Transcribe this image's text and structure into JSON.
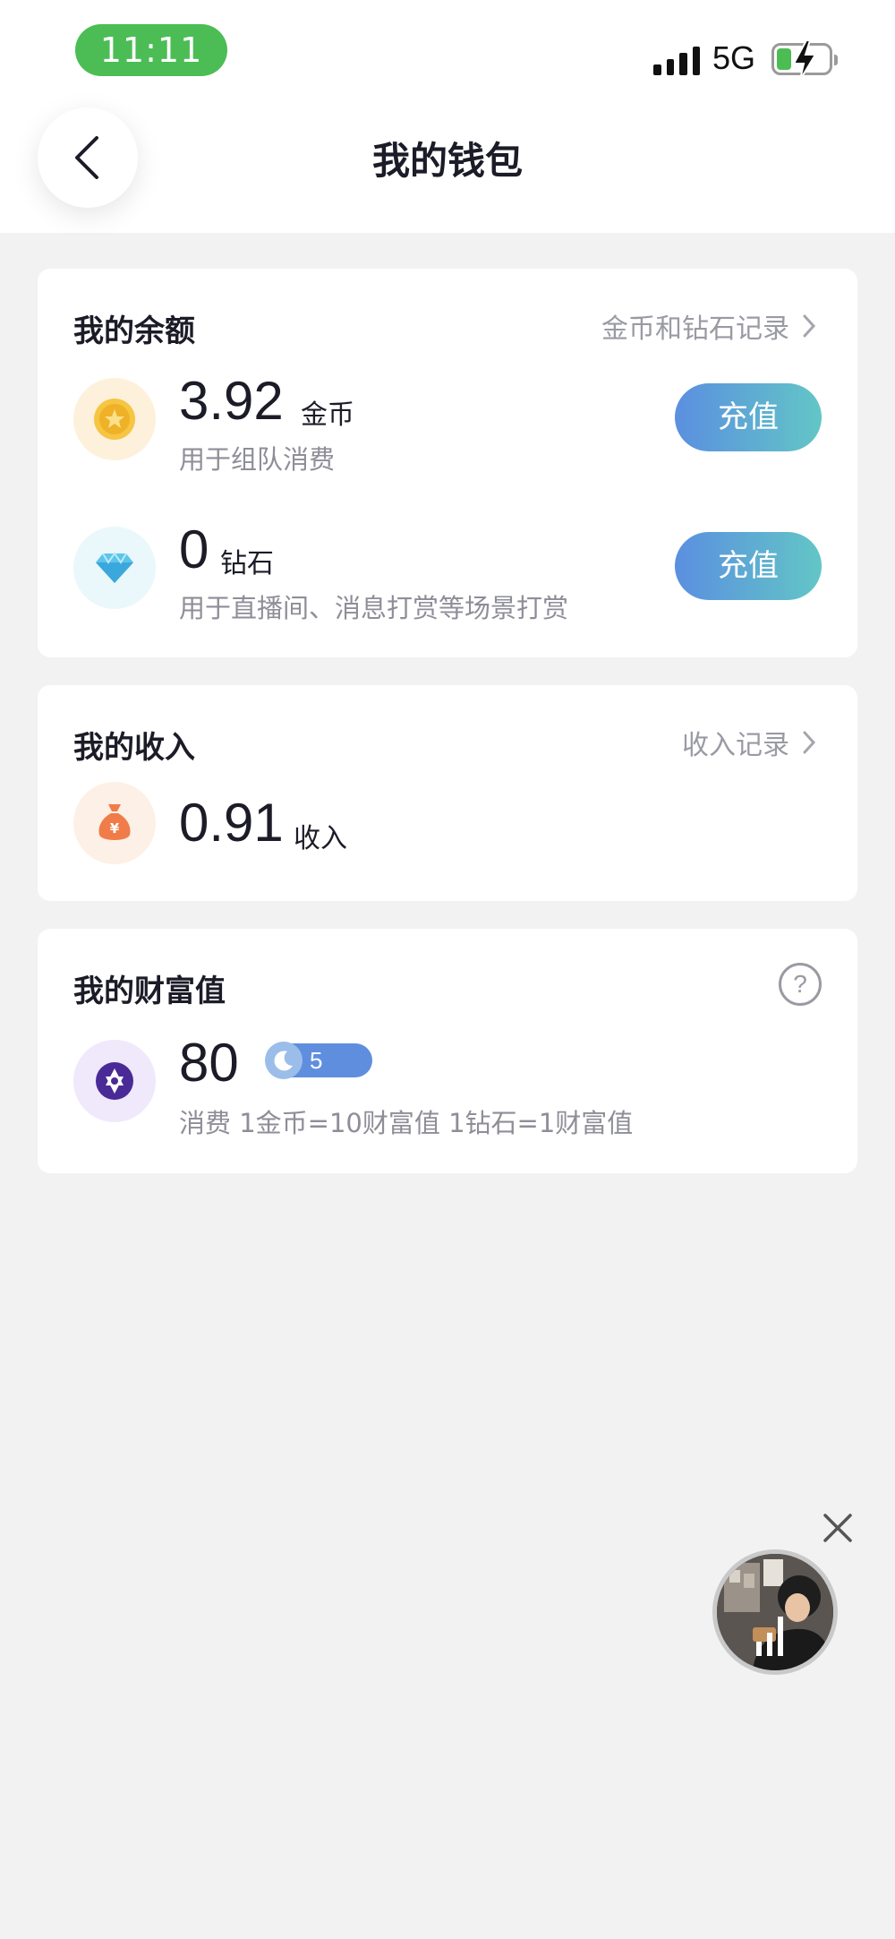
{
  "status_bar": {
    "time": "11:11",
    "network": "5G"
  },
  "nav": {
    "title": "我的钱包"
  },
  "balance": {
    "title": "我的余额",
    "link": "金币和钻石记录",
    "coins": {
      "value": "3.92",
      "unit": "金币",
      "desc": "用于组队消费",
      "button": "充值"
    },
    "diamonds": {
      "value": "0",
      "unit": "钻石",
      "desc": "用于直播间、消息打赏等场景打赏",
      "button": "充值"
    }
  },
  "income": {
    "title": "我的收入",
    "link": "收入记录",
    "value": "0.91",
    "unit": "收入"
  },
  "wealth": {
    "title": "我的财富值",
    "help": "?",
    "value": "80",
    "level": "5",
    "desc": "消费 1金币=10财富值 1钻石=1财富值"
  },
  "colors": {
    "accent_start": "#5b8fe0",
    "accent_end": "#62c6c6",
    "status_green": "#4cbd55"
  },
  "icons": [
    "back-icon",
    "chevron-right-icon",
    "gold-coin-icon",
    "diamond-icon",
    "money-bag-icon",
    "star-icon",
    "moon-icon",
    "help-icon",
    "close-icon"
  ]
}
